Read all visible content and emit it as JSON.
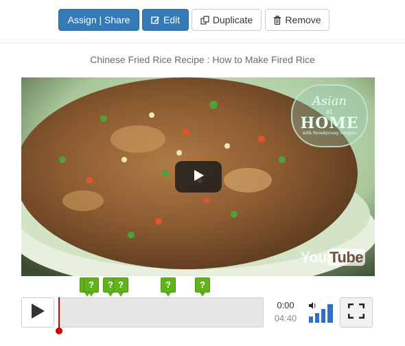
{
  "toolbar": {
    "assign_share_label": "Assign | Share",
    "edit_label": "Edit",
    "duplicate_label": "Duplicate",
    "remove_label": "Remove",
    "primary_color": "#337ab7"
  },
  "video": {
    "title": "Chinese Fried Rice Recipe : How to Make Fired Rice",
    "brand_line1": "Asian",
    "brand_line2": "at",
    "brand_line3": "HOME",
    "brand_line4": "with Seonkyoung Longest",
    "watermark_you": "You",
    "watermark_tube": "Tube",
    "play_icon": "play-icon"
  },
  "markers": [
    {
      "label": "?"
    },
    {
      "label": "?"
    },
    {
      "label": "?"
    },
    {
      "label": "?"
    },
    {
      "label": "?"
    },
    {
      "label": "?"
    }
  ],
  "marker_color": "#61b21b",
  "controls": {
    "current_time": "0:00",
    "total_time": "04:40",
    "progress": 0.0,
    "play_icon": "play-icon",
    "volume_icon": "volume-icon",
    "fullscreen_icon": "fullscreen-icon",
    "playhead_color": "#cc0000"
  }
}
